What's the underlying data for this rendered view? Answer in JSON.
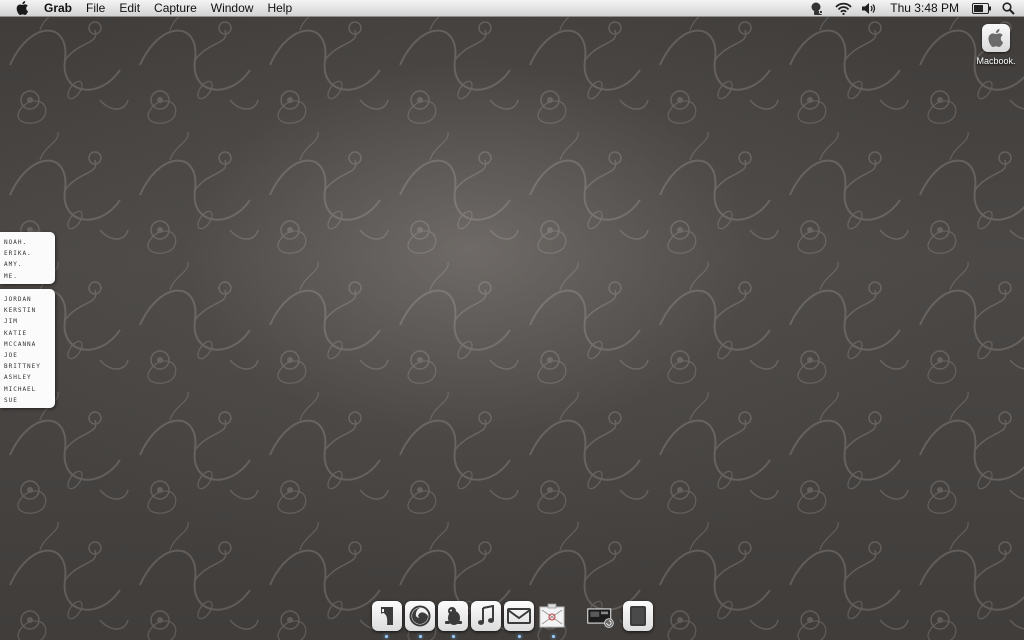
{
  "menubar": {
    "app_name": "Grab",
    "menus": [
      "File",
      "Edit",
      "Capture",
      "Window",
      "Help"
    ],
    "clock": "Thu 3:48 PM",
    "status_icons": [
      "timemachine-icon",
      "wifi-icon",
      "volume-icon",
      "battery-icon",
      "spotlight-icon"
    ]
  },
  "desktop": {
    "drive_label": "Macbook."
  },
  "lists": {
    "top": [
      "NOAH.",
      "ERIKA.",
      "AMY.",
      "ME."
    ],
    "bottom": [
      "JORDAN",
      "KERSTIN",
      "JIM",
      "KATIE",
      "MCCANNA",
      "JOE",
      "BRITTNEY",
      "ASHLEY",
      "MICHAEL",
      "SUE"
    ]
  },
  "dock": {
    "items": [
      {
        "icon": "finder-icon",
        "running": true
      },
      {
        "icon": "firefox-icon",
        "running": true
      },
      {
        "icon": "adium-icon",
        "running": true
      },
      {
        "icon": "itunes-icon",
        "running": false
      },
      {
        "icon": "mail-icon",
        "running": true
      },
      {
        "icon": "grab-icon",
        "running": true
      },
      {
        "icon": "downloads-stack-icon",
        "running": false
      },
      {
        "icon": "trash-icon",
        "running": false
      }
    ]
  },
  "colors": {
    "wallpaper": "#4a4745",
    "menubar": "#e6e6e6",
    "dock_indicator": "#9fd0ff"
  }
}
